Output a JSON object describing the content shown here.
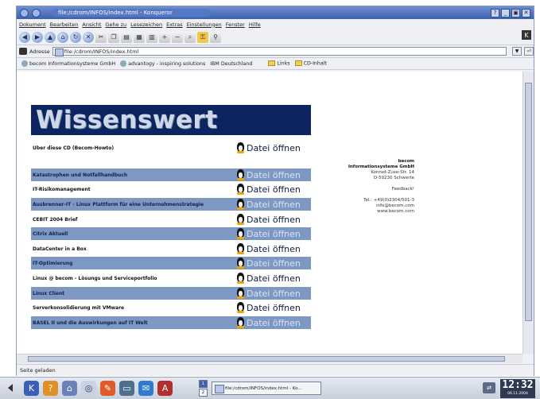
{
  "window": {
    "title": "file:/cdrom/INFOS/index.html - Konqueror",
    "controls": [
      "?",
      "_",
      "▣",
      "✕"
    ]
  },
  "menu": [
    "Dokument",
    "Bearbeiten",
    "Ansicht",
    "Gehe zu",
    "Lesezeichen",
    "Extras",
    "Einstellungen",
    "Fenster",
    "Hilfe"
  ],
  "address": {
    "label": "Adresse",
    "value": "file:/cdrom/INFOS/index.html"
  },
  "bookmarks": [
    "becom Informationsysteme GmbH",
    "advantogy - inspiring solutions",
    "IBM Deutschland",
    "Links",
    "CD-Inhalt"
  ],
  "page": {
    "banner": "Wissenswert",
    "open_label": "Datei öffnen",
    "rows": [
      {
        "label": "Über diese CD (Becom-Howto)",
        "highlight": false
      },
      {
        "label": "Katastrophen und Notfallhandbuch",
        "highlight": true
      },
      {
        "label": "IT-Risikomanagement",
        "highlight": false
      },
      {
        "label": "Ausbrenner-IT - Linux Plattform für eine Unternehmenstrategie",
        "highlight": true
      },
      {
        "label": "CEBIT 2004 Brief",
        "highlight": false
      },
      {
        "label": "Citrix Aktuell",
        "highlight": true
      },
      {
        "label": "DataCenter in a Box",
        "highlight": false
      },
      {
        "label": "IT-Optimierung",
        "highlight": true
      },
      {
        "label": "Linux @ becom - Lösungs und Serviceportfolio",
        "highlight": false
      },
      {
        "label": "Linux Client",
        "highlight": true
      },
      {
        "label": "Serverkonsolidierung mit VMware",
        "highlight": false
      },
      {
        "label": "BASEL II und die Auswirkungen auf IT Welt",
        "highlight": true
      }
    ],
    "contact": {
      "company1": "becom",
      "company2": "Informationsysteme GmbH",
      "street": "Konrad-Zuse-Str. 14",
      "city": "D-50230 Schwerte",
      "feedback": "Feedback!",
      "phone": "Tel.: +49(0)2304/501-3",
      "email": "info@becom.com",
      "web": "www.becom.com"
    }
  },
  "status": "Seite geladen",
  "taskbar": {
    "task": "file:/cdrom/INFOS/index.html - Ko...",
    "pager": [
      "1",
      "2"
    ],
    "clock_time": "12:32",
    "clock_date": "06.11.2004"
  }
}
